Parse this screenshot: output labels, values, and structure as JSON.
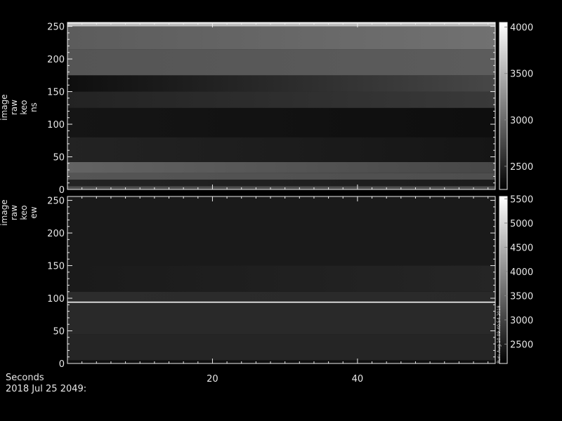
{
  "chart_data": [
    {
      "type": "heatmap",
      "ylabel": [
        "image",
        "raw",
        "keo",
        "ns"
      ],
      "xlim": [
        0,
        59
      ],
      "ylim": [
        0,
        256
      ],
      "yticks": [
        0,
        50,
        100,
        150,
        200,
        250
      ],
      "xticks": [
        20,
        40
      ],
      "colorbar": {
        "ticks": [
          2500,
          3000,
          3500,
          4000
        ],
        "range": [
          2250,
          4050
        ]
      },
      "bands": [
        {
          "y": [
            0,
            5
          ],
          "start": 2800,
          "end": 2800
        },
        {
          "y": [
            5,
            15
          ],
          "start": 2500,
          "end": 2450
        },
        {
          "y": [
            15,
            25
          ],
          "start": 2850,
          "end": 2800
        },
        {
          "y": [
            25,
            42
          ],
          "start": 2950,
          "end": 2750
        },
        {
          "y": [
            42,
            80
          ],
          "start": 2500,
          "end": 2400
        },
        {
          "y": [
            80,
            125
          ],
          "start": 2400,
          "end": 2350
        },
        {
          "y": [
            125,
            150
          ],
          "start": 2500,
          "end": 2650
        },
        {
          "y": [
            150,
            175
          ],
          "start": 2350,
          "end": 2750
        },
        {
          "y": [
            175,
            215
          ],
          "start": 2850,
          "end": 2900
        },
        {
          "y": [
            215,
            250
          ],
          "start": 2900,
          "end": 3050
        },
        {
          "y": [
            250,
            254
          ],
          "start": 3600,
          "end": 3600
        },
        {
          "y": [
            254,
            256
          ],
          "start": 4000,
          "end": 4000
        }
      ]
    },
    {
      "type": "heatmap",
      "ylabel": [
        "image",
        "raw",
        "keo",
        "ew"
      ],
      "xlim": [
        0,
        59
      ],
      "ylim": [
        0,
        256
      ],
      "yticks": [
        0,
        50,
        100,
        150,
        200,
        250
      ],
      "xticks": [
        20,
        40
      ],
      "colorbar": {
        "ticks": [
          2500,
          3000,
          3500,
          4000,
          4500,
          5000,
          5500
        ],
        "range": [
          2100,
          5550
        ]
      },
      "bands": [
        {
          "y": [
            0,
            5
          ],
          "start": 2300,
          "end": 2300
        },
        {
          "y": [
            5,
            45
          ],
          "start": 2600,
          "end": 2600
        },
        {
          "y": [
            45,
            93
          ],
          "start": 2650,
          "end": 2650
        },
        {
          "y": [
            93,
            95
          ],
          "start": 5300,
          "end": 5300
        },
        {
          "y": [
            95,
            110
          ],
          "start": 2700,
          "end": 2650
        },
        {
          "y": [
            110,
            150
          ],
          "start": 2450,
          "end": 2600
        },
        {
          "y": [
            150,
            256
          ],
          "start": 2450,
          "end": 2450
        }
      ]
    }
  ],
  "side_note": "Run: Aug 10 09:40:54 2018",
  "footer": {
    "xlabel": "Seconds",
    "date": "2018 Jul 25 2049:"
  }
}
